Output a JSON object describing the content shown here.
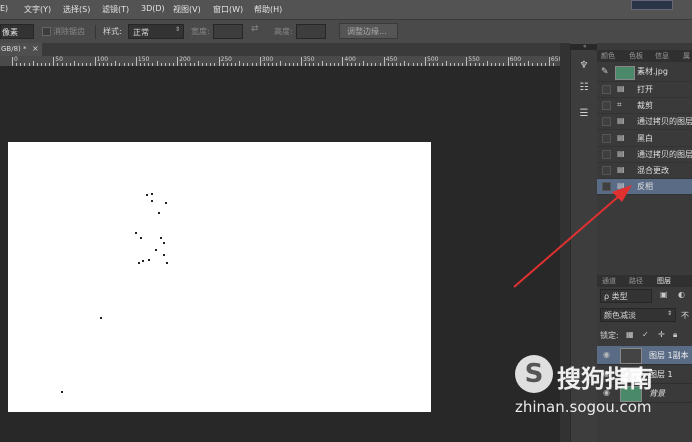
{
  "menubar": {
    "items": [
      "E)",
      "文字(Y)",
      "选择(S)",
      "滤镜(T)",
      "3D(D)",
      "视图(V)",
      "窗口(W)",
      "帮助(H)"
    ]
  },
  "options": {
    "unit_value": "像素",
    "antialias_label": "消除锯齿",
    "style_label": "样式:",
    "style_value": "正常",
    "width_label": "宽度:",
    "height_label": "高度:",
    "refine_edge_label": "调整边缘..."
  },
  "document": {
    "tab_label": "GB/8) *",
    "close_glyph": "×"
  },
  "ruler": {
    "labels": [
      "0",
      "50",
      "100",
      "150",
      "200",
      "250",
      "300",
      "350",
      "400",
      "450",
      "500",
      "550",
      "600",
      "650",
      "700",
      "750",
      "800",
      "850",
      "900",
      "950",
      "1000",
      "1050",
      "1100",
      "1150",
      "1200",
      "1250",
      "1300",
      "1350",
      "1400",
      "1450",
      "1500",
      "1550",
      "1600",
      "1650",
      "1700",
      "1750",
      "1800",
      "1850",
      "1900",
      "1950",
      "2000",
      "2050",
      "2100",
      "2150",
      "2200",
      "2250",
      "2300",
      "2350",
      "2400",
      "2450",
      "2500",
      "2550",
      "2600"
    ]
  },
  "panel_top": {
    "tabs": [
      "颜色",
      "色板",
      "信息",
      "属"
    ],
    "snapshot_label": "素材.jpg",
    "history": [
      "打开",
      "裁剪",
      "通过拷贝的图层",
      "黑白",
      "通过拷贝的图层",
      "混合更改",
      "反相"
    ],
    "selected_index": 6
  },
  "panel_layers": {
    "tabs": [
      "通道",
      "路径",
      "图层"
    ],
    "filter_label": "ρ 类型",
    "blend_mode": "颜色减淡",
    "opacity_label": "不",
    "lock_label": "锁定:",
    "layers": [
      "图层 1副本",
      "图层 1",
      "背景"
    ]
  },
  "watermark": {
    "brand": "搜狗指南",
    "url": "zhinan.sogou.com",
    "logo_letter": "S"
  },
  "colors": {
    "selected_history": "#5a6b85",
    "arrow": "#e03030"
  }
}
